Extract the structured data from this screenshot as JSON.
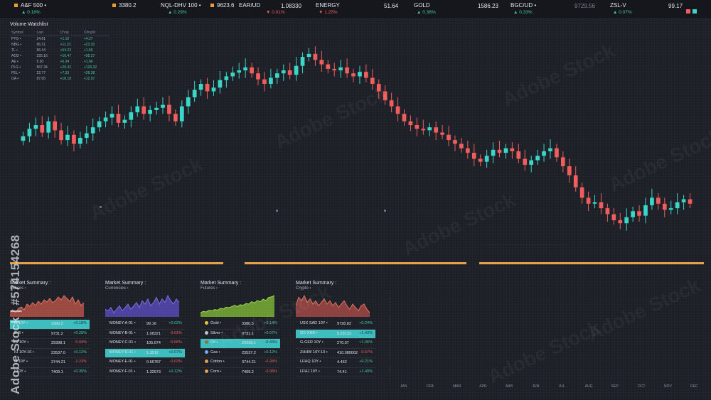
{
  "ticker": [
    {
      "name": "A&F 500",
      "value": "",
      "change": "0.18%",
      "dir": "up",
      "accent": "#f29b30"
    },
    {
      "name": "3380.2",
      "value": "",
      "change": "",
      "dir": "up",
      "accent": "#f29b30"
    },
    {
      "name": "NQL-DHV 100",
      "value": "",
      "change": "0.29%",
      "dir": "up",
      "accent": ""
    },
    {
      "name": "9623.6",
      "value": "",
      "change": "",
      "dir": "up",
      "accent": "#f29b30"
    },
    {
      "name": "EAR/UD",
      "value": "1.08330",
      "change": "0.01%",
      "dir": "dn",
      "accent": ""
    },
    {
      "name": "ENERGY",
      "value": "51.64",
      "change": "1.25%",
      "dir": "dn",
      "accent": ""
    },
    {
      "name": "GOLD",
      "value": "1586.23",
      "change": "0.36%",
      "dir": "up",
      "accent": "#f29b30"
    },
    {
      "name": "BGC/UD",
      "value": "9729.56",
      "change": "0.33%",
      "dir": "up",
      "accent": ""
    },
    {
      "name": "ZSL-V",
      "value": "99.17",
      "change": "0.07%",
      "dir": "up",
      "accent": ""
    }
  ],
  "watchlist": {
    "title": "Volume Watchlist",
    "headers": [
      "Symbol",
      "Last",
      "Chng",
      "Chng%"
    ],
    "rows": [
      [
        "PTG •",
        "24.61",
        "+1.10",
        "+4.27"
      ],
      [
        "NBG •",
        "96.11",
        "+11.22",
        "+23.32"
      ],
      [
        "TL •",
        "96.44",
        "+64.23",
        "+1.55"
      ],
      [
        "AOD •",
        "225.16",
        "+16.47",
        "+95.27"
      ],
      [
        "AE •",
        "5.30",
        "+6.34",
        "+1.46"
      ],
      [
        "PLG •",
        "567.34",
        "+20.42",
        "+126.32"
      ],
      [
        "FEL •",
        "22.77",
        "+7.33",
        "+26.38"
      ],
      [
        "OA •",
        "87.65",
        "+18.18",
        "+12.97"
      ]
    ]
  },
  "main_chart": {
    "type": "candlestick",
    "up_color": "#3ad6c8",
    "down_color": "#ef5d5d",
    "closes": [
      180,
      170,
      165,
      175,
      160,
      172,
      185,
      178,
      190,
      182,
      176,
      168,
      160,
      155,
      150,
      162,
      158,
      148,
      140,
      150,
      145,
      142,
      138,
      150,
      160,
      140,
      128,
      118,
      110,
      120,
      115,
      105,
      100,
      95,
      92,
      88,
      96,
      104,
      110,
      102,
      96,
      92,
      98,
      86,
      74,
      70,
      78,
      84,
      90,
      92,
      88,
      96,
      100,
      94,
      102,
      110,
      120,
      132,
      140,
      150,
      160,
      165,
      170,
      172,
      168,
      175,
      178,
      185,
      190,
      196,
      202,
      210,
      214,
      206,
      198,
      202,
      196,
      200,
      210,
      218,
      212,
      206,
      200,
      196,
      208,
      220,
      232,
      248,
      262,
      270,
      268,
      276,
      284,
      292,
      296,
      288,
      280,
      286,
      272,
      262,
      270,
      278,
      276,
      268,
      264,
      270
    ],
    "month_labels": [
      "JAN",
      "FEB",
      "MAR",
      "APR",
      "MAY",
      "JUN",
      "JUL",
      "AUG",
      "SEP",
      "OCT",
      "NOV",
      "DEC"
    ]
  },
  "panels": [
    {
      "title": "Market Summary :",
      "sub": "Indices",
      "color": "#e2725f",
      "fill": "#c55a4c",
      "spark": [
        40,
        38,
        42,
        36,
        34,
        38,
        30,
        33,
        28,
        32,
        26,
        30,
        24,
        27,
        22,
        28,
        25,
        20,
        24,
        18,
        22,
        26,
        20,
        30,
        24,
        32,
        28
      ],
      "rows": [
        {
          "name": "IL 10Y •",
          "value": "3380.2",
          "change": "+0.18%",
          "dir": "up",
          "hl": true
        },
        {
          "name": "E-B •",
          "value": "9731.2",
          "change": "+0.28%",
          "dir": "up",
          "hl": false
        },
        {
          "name": "IU 10Y •",
          "value": "29398.1",
          "change": "-0.04%",
          "dir": "dn",
          "hl": false
        },
        {
          "name": "IU 10Y-10 •",
          "value": "23537.0",
          "change": "+0.12%",
          "dir": "up",
          "hl": false
        },
        {
          "name": "IJ 10Y •",
          "value": "3744.21",
          "change": "-1.23%",
          "dir": "dn",
          "hl": false
        },
        {
          "name": "I 10Y •",
          "value": "7409.1",
          "change": "+0.35%",
          "dir": "up",
          "hl": false
        }
      ]
    },
    {
      "title": "Market Summary :",
      "sub": "Currencies",
      "color": "#7b6ee6",
      "fill": "#5d50c8",
      "spark": [
        30,
        32,
        28,
        34,
        30,
        26,
        32,
        28,
        24,
        30,
        26,
        22,
        28,
        20,
        24,
        18,
        26,
        22,
        16,
        24,
        18,
        22,
        14,
        20,
        24,
        18,
        22
      ],
      "rows": [
        {
          "name": "MONEY-A-01 •",
          "value": "99.16",
          "change": "+0.02%",
          "dir": "up",
          "hl": false
        },
        {
          "name": "MONEY-B-01 •",
          "value": "1.08321",
          "change": "-0.01%",
          "dir": "dn",
          "hl": false
        },
        {
          "name": "MONEY-C-01 •",
          "value": "105.674",
          "change": "-0.06%",
          "dir": "dn",
          "hl": false
        },
        {
          "name": "MONEY-D-01 •",
          "value": "1.3012",
          "change": "+0.07%",
          "dir": "up",
          "hl": true
        },
        {
          "name": "MONEY-E-01 •",
          "value": "0.66787",
          "change": "-0.03%",
          "dir": "dn",
          "hl": false
        },
        {
          "name": "MONEY-F-01 •",
          "value": "1.32573",
          "change": "+0.12%",
          "dir": "up",
          "hl": false
        }
      ]
    },
    {
      "title": "Market Summary :",
      "sub": "Futures",
      "color": "#9fd84e",
      "fill": "#87c23a",
      "spark": [
        40,
        38,
        39,
        36,
        37,
        35,
        36,
        33,
        34,
        31,
        32,
        30,
        28,
        30,
        27,
        28,
        25,
        26,
        22,
        24,
        20,
        22,
        18,
        20,
        15,
        14,
        12
      ],
      "rows": [
        {
          "name": "Gold •",
          "value": "3380.5",
          "change": "+0.14%",
          "dir": "up",
          "hl": false,
          "dot": "#f2c230"
        },
        {
          "name": "Silver •",
          "value": "9731.1",
          "change": "+0.07%",
          "dir": "up",
          "hl": false,
          "dot": "#c0c4cc"
        },
        {
          "name": "Oil •",
          "value": "29398.1",
          "change": "-0.43%",
          "dir": "dn",
          "hl": true,
          "dot": "#8a6f4a"
        },
        {
          "name": "Gas •",
          "value": "23537.2",
          "change": "+0.12%",
          "dir": "up",
          "hl": false,
          "dot": "#6fb3e8"
        },
        {
          "name": "Cotton •",
          "value": "3744.21",
          "change": "-0.28%",
          "dir": "dn",
          "hl": false,
          "dot": "#e8a14a"
        },
        {
          "name": "Corn •",
          "value": "7409.2",
          "change": "-0.08%",
          "dir": "dn",
          "hl": false,
          "dot": "#e8a14a"
        }
      ]
    },
    {
      "title": "Market Summary :",
      "sub": "Crypto",
      "color": "#e2725f",
      "fill": "#b14f4a",
      "spark": [
        30,
        20,
        24,
        18,
        26,
        22,
        28,
        24,
        30,
        26,
        22,
        28,
        24,
        30,
        26,
        32,
        28,
        24,
        30,
        34,
        28,
        32,
        36,
        30,
        28,
        34,
        38
      ],
      "rows": [
        {
          "name": "USX SAD 10Y •",
          "value": "9728.82",
          "change": "+0.24%",
          "dir": "up",
          "hl": false
        },
        {
          "name": "GS-XHD •",
          "value": "0.29133",
          "change": "+1.43%",
          "dir": "up",
          "hl": true
        },
        {
          "name": "G-GER 10Y •",
          "value": "270.07",
          "change": "+1.06%",
          "dir": "up",
          "hl": false
        },
        {
          "name": "ZHHW 10Y-10 •",
          "value": "410.080002",
          "change": "-0.67%",
          "dir": "dn",
          "hl": false
        },
        {
          "name": "LFHQ 10Y •",
          "value": "4.452",
          "change": "+0.21%",
          "dir": "up",
          "hl": false
        },
        {
          "name": "LFHJ 10Y •",
          "value": "74.41",
          "change": "+1.49%",
          "dir": "up",
          "hl": false
        }
      ]
    }
  ],
  "months": [
    "JAN",
    "FEB",
    "MAR",
    "APR",
    "MAY",
    "JUN",
    "JUL",
    "AUG",
    "SEP",
    "OCT",
    "NOV",
    "DEC"
  ],
  "watermark": {
    "text": "Adobe Stock | #574154268",
    "overlay": "Adobe Stock"
  }
}
